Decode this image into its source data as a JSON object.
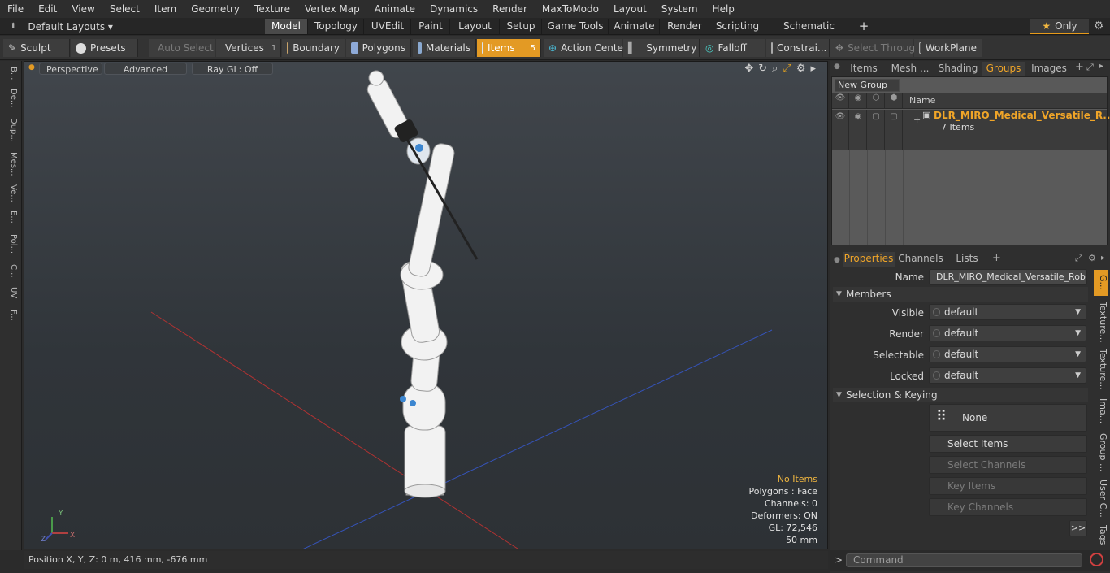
{
  "menubar": {
    "items": [
      "File",
      "Edit",
      "View",
      "Select",
      "Item",
      "Geometry",
      "Texture",
      "Vertex Map",
      "Animate",
      "Dynamics",
      "Render",
      "MaxToModo",
      "Layout",
      "System",
      "Help"
    ]
  },
  "layoutbar": {
    "layout_dropdown": "Default Layouts",
    "tabs": [
      "Model",
      "Topology",
      "UVEdit",
      "Paint",
      "Layout",
      "Setup",
      "Game Tools",
      "Animate",
      "Render",
      "Scripting",
      "Schematic Fusion"
    ],
    "active_tab": "Model",
    "only_label": "Only"
  },
  "toolbar": {
    "sculpt": "Sculpt",
    "presets": "Presets",
    "auto_select": "Auto Select",
    "vertices": "Vertices",
    "vertices_count": "1",
    "boundary": "Boundary",
    "polygons": "Polygons",
    "materials": "Materials",
    "items": "Items",
    "items_count": "5",
    "action_center": "Action Center",
    "symmetry": "Symmetry",
    "falloff": "Falloff",
    "constraints": "Constrai...",
    "select_through": "Select Through",
    "workplane": "WorkPlane"
  },
  "leftstrip": {
    "tabs": [
      "B...",
      "De...",
      "Dup...",
      "Mes...",
      "Ve...",
      "E...",
      "Pol...",
      "C...",
      "UV",
      "F..."
    ]
  },
  "viewport": {
    "perspective": "Perspective",
    "advanced": "Advanced",
    "raygl": "Ray GL: Off",
    "info": {
      "no_items": "No Items",
      "polygons": "Polygons : Face",
      "channels": "Channels: 0",
      "deformers": "Deformers: ON",
      "gl": "GL: 72,546",
      "scale": "50 mm"
    },
    "axis_x": "X",
    "axis_y": "Y",
    "axis_z": "Z"
  },
  "statusbar": {
    "position": "Position X, Y, Z:   0 m, 416 mm, -676 mm"
  },
  "rightpanel": {
    "top_tabs": [
      "Items",
      "Mesh ...",
      "Shading",
      "Groups",
      "Images"
    ],
    "active_top_tab": "Groups",
    "new_group": "New Group",
    "col_name": "Name",
    "group_name": "DLR_MIRO_Medical_Versatile_R...",
    "group_count": "7 Items",
    "prop_tabs": [
      "Properties",
      "Channels",
      "Lists"
    ],
    "active_prop_tab": "Properties",
    "name_label": "Name",
    "name_value": "DLR_MIRO_Medical_Versatile_Robotic",
    "members_section": "Members",
    "visible_label": "Visible",
    "visible_value": "default",
    "render_label": "Render",
    "render_value": "default",
    "selectable_label": "Selectable",
    "selectable_value": "default",
    "locked_label": "Locked",
    "locked_value": "default",
    "selection_section": "Selection & Keying",
    "none_btn": "None",
    "select_items": "Select Items",
    "select_channels": "Select Channels",
    "key_items": "Key Items",
    "key_channels": "Key Channels",
    "more_btn": ">>",
    "side_tabs": [
      "G...",
      "Texture...",
      "Texture...",
      "Ima...",
      "Group ...",
      "User C...",
      "Tags"
    ],
    "command_placeholder": "Command",
    "cmd_prompt": ">"
  },
  "colors": {
    "accent": "#e39a24",
    "group_name": "#f0a528",
    "axis_x_line": "#c03030",
    "axis_z_line": "#3050c0"
  }
}
